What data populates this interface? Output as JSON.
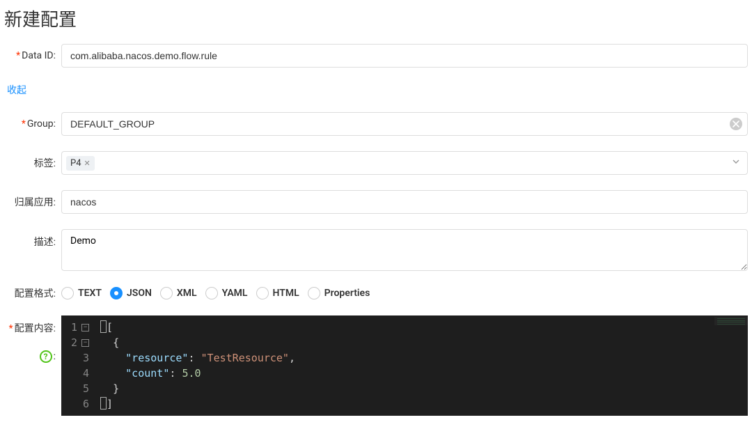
{
  "title": "新建配置",
  "collapse_text": "收起",
  "labels": {
    "data_id": "Data ID:",
    "group": "Group:",
    "tags": "标签:",
    "app": "归属应用:",
    "desc": "描述:",
    "format": "配置格式:",
    "content": "配置内容:"
  },
  "fields": {
    "data_id": "com.alibaba.nacos.demo.flow.rule",
    "group": "DEFAULT_GROUP",
    "tag_value": "P4",
    "app": "nacos",
    "desc": "Demo"
  },
  "formats": {
    "options": [
      "TEXT",
      "JSON",
      "XML",
      "YAML",
      "HTML",
      "Properties"
    ],
    "selected": "JSON"
  },
  "editor": {
    "line_numbers": [
      "1",
      "2",
      "3",
      "4",
      "5",
      "6"
    ],
    "lines": {
      "l1_open": "[",
      "l2_brace": "{",
      "l3_key": "\"resource\"",
      "l3_colon": ": ",
      "l3_val": "\"TestResource\"",
      "l3_comma": ",",
      "l4_key": "\"count\"",
      "l4_colon": ": ",
      "l4_val": "5.0",
      "l5_brace": "}",
      "l6_close": "]"
    }
  }
}
